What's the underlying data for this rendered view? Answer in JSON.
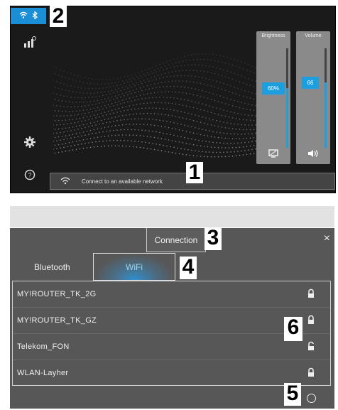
{
  "top": {
    "status_button_icons": [
      "wifi-icon",
      "bluetooth-icon"
    ],
    "sidebar_icons": [
      "network-icon",
      "settings-gear-icon",
      "help-icon"
    ],
    "brightness": {
      "label": "Brightness",
      "value_text": "60%",
      "level": 0.6,
      "icon": "display-icon"
    },
    "volume": {
      "label": "Volume",
      "value_text": "66",
      "level": 0.66,
      "icon": "speaker-icon"
    },
    "connect_prompt": "Connect to an available network"
  },
  "callouts": {
    "c1": "1",
    "c2": "2",
    "c3": "3",
    "c4": "4",
    "c5": "5",
    "c6": "6"
  },
  "bottom": {
    "connection_label": "Connection",
    "close_label": "×",
    "tabs": {
      "bluetooth": "Bluetooth",
      "wifi": "WiFi"
    },
    "networks": [
      {
        "name": "MY!ROUTER_TK_2G",
        "locked": true
      },
      {
        "name": "MY!ROUTER_TK_GZ",
        "locked": true
      },
      {
        "name": "Telekom_FON",
        "locked": false
      },
      {
        "name": "WLAN-Layher",
        "locked": true
      }
    ]
  },
  "colors": {
    "accent": "#1b9fe0",
    "panel": "#8a8a8a",
    "dark_bg": "#1a1a1a",
    "dialog_bg": "#575757"
  }
}
